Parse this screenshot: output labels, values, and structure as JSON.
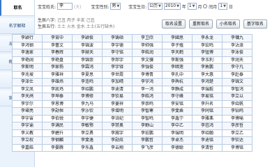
{
  "sidebar": {
    "items": [
      {
        "label": "取名"
      },
      {
        "label": "名字解释"
      },
      {
        "label": "五格分析"
      },
      {
        "label": "称骨算命"
      },
      {
        "label": "帮助"
      },
      {
        "label": "官方网站"
      }
    ]
  },
  "form": {
    "surname_label": "宝宝姓氏:",
    "surname_value": "李",
    "surname_placeholder": "(大)",
    "gender_label": "宝宝性别:",
    "gender_value": "男",
    "birth_label": "宝宝生日:",
    "calendar_value": "公历",
    "year_value": "2010",
    "year_unit": "年",
    "month_value": "1",
    "month_unit": "月",
    "leap_label": "闰月",
    "day_value": "1",
    "day_unit": "日"
  },
  "info": {
    "bazi_label": "生辰八字:",
    "bazi_value": "己丑 丙子 辛亥 己丑",
    "wuxing_label": "生辰五行:",
    "wuxing_value": "土土 火水 金水 土土(五行缺木)"
  },
  "buttons": {
    "settings": "取名设置",
    "regenerate": "重新取名",
    "small_name": "小名取名",
    "fortune": "基字取名"
  },
  "names": [
    [
      "李颖行",
      "李宵中",
      "李颖俊",
      "李铸硕",
      "李卫欣",
      "李國思",
      "李永龙",
      "李镛九"
    ],
    [
      "李鸿钢",
      "李蕾文",
      "李锦波",
      "李宇德",
      "李帅强",
      "李子殖",
      "李宏鸣",
      "李沾浪"
    ],
    [
      "李逸家",
      "李春辉",
      "李赫天",
      "李守铭",
      "李皓润",
      "李天鹤",
      "李钮博",
      "李泳俊"
    ],
    [
      "李艳阔",
      "李艳盘",
      "李锦崇",
      "李邦宇",
      "李文骥",
      "李斯强",
      "李玉利",
      "李润天"
    ],
    [
      "李斯明",
      "李家杨",
      "李霖鸿",
      "李宇铎",
      "李蚀俊",
      "李暗莲",
      "李敦鹏",
      "李守凡"
    ],
    [
      "李兆坡",
      "李雅祥",
      "李夏思",
      "李世霞",
      "李博青",
      "李孔中",
      "李大惠",
      "李赴泰"
    ],
    [
      "李泽仕",
      "李雄炜",
      "李连鸣",
      "李加晴",
      "李宇鸿",
      "李舆杭",
      "李鸿楚",
      "李锦文"
    ],
    [
      "李文凤",
      "李凯鸡",
      "李绍鹏",
      "李迪清",
      "李一鸿",
      "李静成",
      "李瑞毅",
      "李智鸿"
    ],
    [
      "李天鸪",
      "李坤泰",
      "李博修",
      "李钦易",
      "李皓鸿",
      "李守峰",
      "李易铭",
      "李立以"
    ],
    [
      "李宇尔",
      "李恩博",
      "李九马",
      "李菱祥",
      "李崇鸣",
      "李安铭",
      "李升名",
      "李绍帆"
    ],
    [
      "李珺亮",
      "李勋恒",
      "李沙钦",
      "李增明",
      "李智寒",
      "李斐乘",
      "李同铭",
      "李钻鸣"
    ],
    [
      "李宇宙",
      "李伯锐",
      "李宇捷",
      "李诗纪",
      "李智鸣",
      "李鑫宁",
      "李雅弗",
      "李博喻"
    ],
    [
      "李宇谕",
      "李满民",
      "李敏鄂",
      "李禁奥",
      "李野山",
      "李中乙",
      "李芭鸿",
      "李彦哲"
    ],
    [
      "李义教",
      "李碧升",
      "李立勇",
      "李嵩宇",
      "李宏鹏",
      "李瑞明",
      "李绍翰",
      "李立乙"
    ],
    [
      "李立权",
      "李钢麟",
      "李斐逸",
      "李勋炫",
      "李鹏哲",
      "李卓杰",
      "李迪铭",
      "李钦达"
    ],
    [
      "李嘉皓",
      "李晏腾",
      "李东鑫",
      "李云翔",
      "李飞彦",
      "李德聪",
      "李清哲",
      "李博铭"
    ]
  ]
}
